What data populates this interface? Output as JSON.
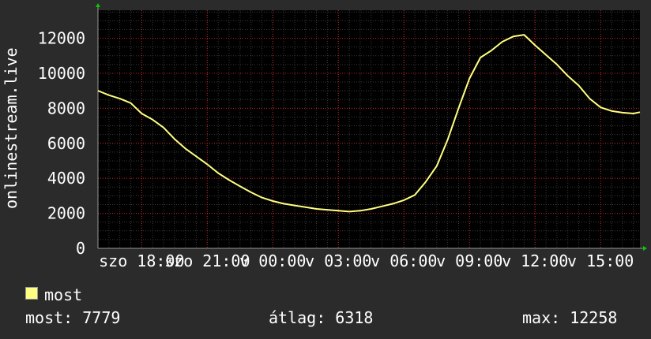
{
  "chart_data": {
    "type": "line",
    "ylabel": "onlinestream.live",
    "ylim": [
      0,
      13600
    ],
    "y_ticks": [
      0,
      2000,
      4000,
      6000,
      8000,
      10000,
      12000
    ],
    "grid": true,
    "x_tick_labels": [
      "szo 18:00",
      "szo 21:00",
      "v 00:00",
      "v 03:00",
      "v 06:00",
      "v 09:00",
      "v 12:00",
      "v 15:00"
    ],
    "x_range_hours": [
      -2.0,
      22.8
    ],
    "colors": {
      "background": "#000000",
      "grid_major": "#c81e1e",
      "grid_minor": "#3a3a3a",
      "line": "#ffff80",
      "frame": "#999999",
      "axis_arrow": "#00cc00"
    },
    "series": [
      {
        "name": "most",
        "x": [
          -2.0,
          -1.5,
          -1.0,
          -0.5,
          0.0,
          0.5,
          1.0,
          1.5,
          2.0,
          2.5,
          3.0,
          3.5,
          4.0,
          4.5,
          5.0,
          5.5,
          6.0,
          6.5,
          7.0,
          7.5,
          8.0,
          8.5,
          9.0,
          9.5,
          10.0,
          10.5,
          11.0,
          11.5,
          12.0,
          12.5,
          13.0,
          13.5,
          14.0,
          14.5,
          15.0,
          15.5,
          16.0,
          16.5,
          17.0,
          17.5,
          18.0,
          18.5,
          19.0,
          19.5,
          20.0,
          20.5,
          21.0,
          21.5,
          22.0,
          22.5,
          22.8
        ],
        "values": [
          9000,
          8750,
          8550,
          8300,
          7700,
          7350,
          6900,
          6250,
          5700,
          5250,
          4800,
          4300,
          3900,
          3550,
          3200,
          2900,
          2700,
          2550,
          2450,
          2350,
          2250,
          2200,
          2150,
          2100,
          2150,
          2250,
          2400,
          2550,
          2750,
          3050,
          3800,
          4700,
          6200,
          8000,
          9700,
          10900,
          11300,
          11800,
          12100,
          12200,
          11600,
          11050,
          10500,
          9850,
          9300,
          8550,
          8050,
          7850,
          7750,
          7700,
          7779
        ]
      }
    ]
  },
  "legend": {
    "label": "most"
  },
  "stats": {
    "current": "most: 7779",
    "average": "átlag: 6318",
    "max": "max: 12258"
  }
}
